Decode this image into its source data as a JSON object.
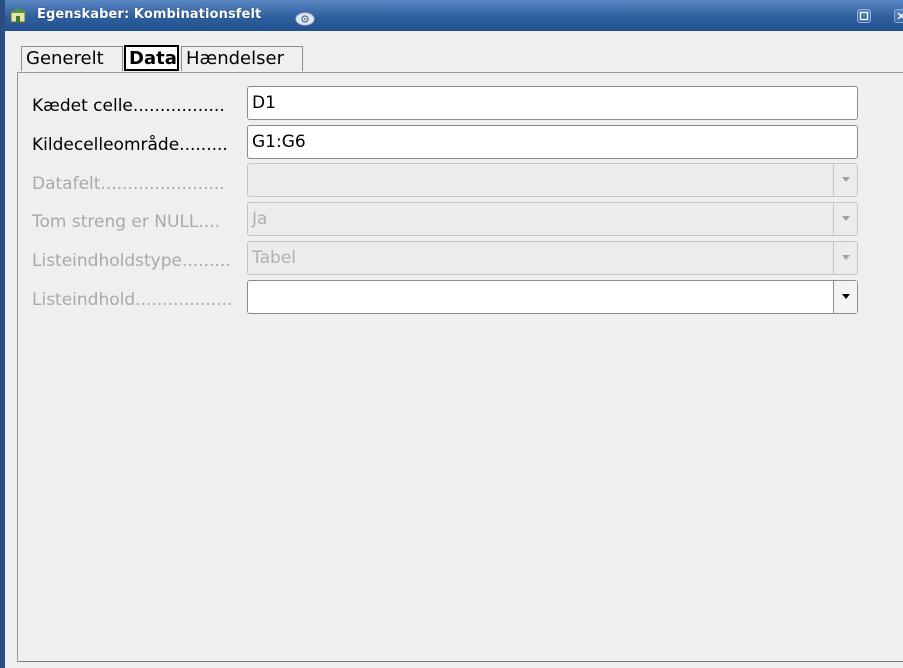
{
  "window": {
    "title": "Egenskaber: Kombinationsfelt",
    "app_icon": "office-app-icon",
    "badge_icon": "spiral-badge-icon",
    "buttons": [
      "maximize-icon",
      "close-icon"
    ]
  },
  "tabs": [
    {
      "label": "Generelt",
      "selected": false
    },
    {
      "label": "Data",
      "selected": true
    },
    {
      "label": "Hændelser",
      "selected": false
    }
  ],
  "form": {
    "linked_cell": {
      "label": "Kædet celle.................",
      "value": "D1",
      "enabled": true
    },
    "source_range": {
      "label": "Kildecelleområde.........",
      "value": "G1:G6",
      "enabled": true
    },
    "data_field": {
      "label": "Datafelt.......................",
      "value": "",
      "enabled": false
    },
    "empty_string_null": {
      "label": "Tom streng er NULL....",
      "value": "Ja",
      "enabled": false
    },
    "list_content_type": {
      "label": "Listeindholdstype.........",
      "value": "Tabel",
      "enabled": false
    },
    "list_content": {
      "label": "Listeindhold..................",
      "value": "",
      "enabled": true
    }
  },
  "colors": {
    "titlebar": "#2f5f9e",
    "panel": "#efefef",
    "disabled_text": "#a9a9a9"
  }
}
